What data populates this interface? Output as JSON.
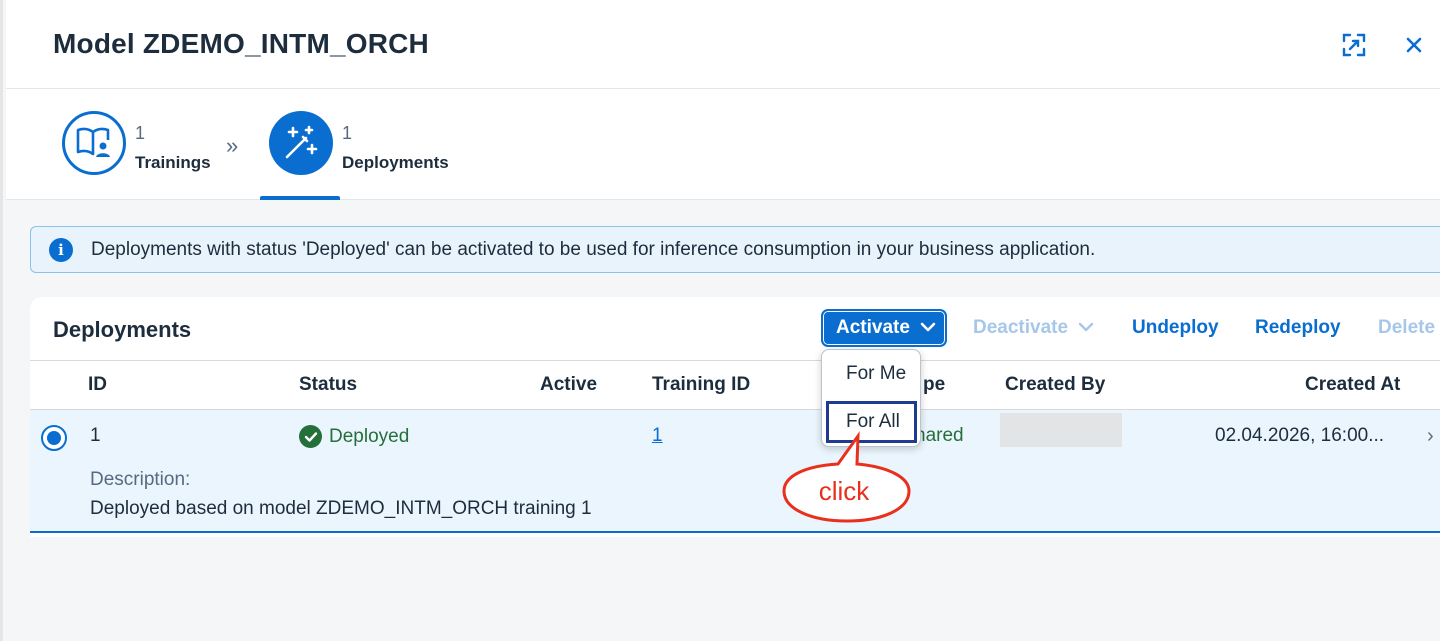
{
  "header": {
    "title": "Model ZDEMO_INTM_ORCH",
    "expand_icon": "full-screen-icon",
    "close_icon": "close-icon"
  },
  "steps": [
    {
      "count": "1",
      "label": "Trainings",
      "icon": "book-person-icon",
      "selected": false
    },
    {
      "count": "1",
      "label": "Deployments",
      "icon": "magic-wand-icon",
      "selected": true
    }
  ],
  "step_separator": "»",
  "info_strip": {
    "icon": "info-icon",
    "text": "Deployments with status 'Deployed' can be activated to be used for inference consumption in your business application."
  },
  "panel": {
    "title": "Deployments",
    "toolbar": {
      "activate": "Activate",
      "deactivate": "Deactivate",
      "undeploy": "Undeploy",
      "redeploy": "Redeploy",
      "delete": "Delete"
    },
    "columns": [
      "ID",
      "Status",
      "Active",
      "Training ID",
      "pe",
      "Created By",
      "Created At"
    ],
    "rows": [
      {
        "id": "1",
        "status": "Deployed",
        "active": "",
        "training_id": "1",
        "type": "hared",
        "created_by": "",
        "created_at": "02.04.2026, 16:00...",
        "description_label": "Description:",
        "description": "Deployed based on model ZDEMO_INTM_ORCH training 1",
        "selected": true
      }
    ]
  },
  "activate_menu": {
    "items": [
      "For Me",
      "For All"
    ],
    "focused": "For All"
  },
  "annotation": {
    "text": "click",
    "color": "#e8301c"
  },
  "colors": {
    "brand_blue": "#0a6ed1",
    "success_green": "#256f3a",
    "disabled_blue": "#a7c7ea",
    "row_selected_bg": "#ebf5fe",
    "info_bg": "#e8f3fb"
  }
}
